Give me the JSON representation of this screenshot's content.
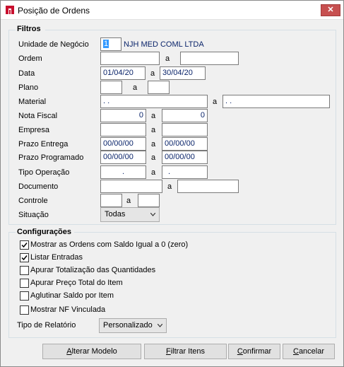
{
  "window": {
    "title": "Posição de Ordens",
    "close_glyph": "✕"
  },
  "filtros": {
    "title": "Filtros",
    "unidade": {
      "label": "Unidade de Negócio",
      "value": "1",
      "company": "NJH MED COML LTDA"
    },
    "ordem": {
      "label": "Ordem",
      "sep": "a",
      "from": "",
      "to": ""
    },
    "data": {
      "label": "Data",
      "sep": "a",
      "from": "01/04/20",
      "to": "30/04/20"
    },
    "plano": {
      "label": "Plano",
      "sep": "a",
      "from": "",
      "to": ""
    },
    "material": {
      "label": "Material",
      "sep": "a",
      "from": ". .",
      "to": ". ."
    },
    "nota_fiscal": {
      "label": "Nota Fiscal",
      "sep": "a",
      "from": "0",
      "to": "0"
    },
    "empresa": {
      "label": "Empresa",
      "sep": "a",
      "from": "",
      "to": ""
    },
    "prazo_entrega": {
      "label": "Prazo Entrega",
      "sep": "a",
      "from": "00/00/00",
      "to": "00/00/00"
    },
    "prazo_programado": {
      "label": "Prazo Programado",
      "sep": "a",
      "from": "00/00/00",
      "to": "00/00/00"
    },
    "tipo_operacao": {
      "label": "Tipo Operação",
      "sep": "a",
      "from": ".",
      "to": "."
    },
    "documento": {
      "label": "Documento",
      "sep": "a",
      "from": "",
      "to": ""
    },
    "controle": {
      "label": "Controle",
      "sep": "a",
      "from": "",
      "to": ""
    },
    "situacao": {
      "label": "Situação",
      "value": "Todas"
    }
  },
  "configuracoes": {
    "title": "Configurações",
    "options": [
      {
        "label": "Mostrar as Ordens com Saldo Igual a 0 (zero)",
        "checked": true
      },
      {
        "label": "Listar Entradas",
        "checked": true
      },
      {
        "label": "Apurar Totalização das Quantidades",
        "checked": false
      },
      {
        "label": "Apurar Preço Total do Item",
        "checked": false
      },
      {
        "label": "Aglutinar Saldo por Item",
        "checked": false
      },
      {
        "label": "Mostrar NF Vinculada",
        "checked": false
      }
    ],
    "tipo_relatorio": {
      "label": "Tipo de Relatório",
      "value": "Personalizado"
    }
  },
  "buttons": {
    "alterar_modelo": {
      "mnemonic": "A",
      "rest": "lterar Modelo"
    },
    "filtrar_itens": {
      "mnemonic": "F",
      "rest": "iltrar Itens"
    },
    "confirmar": {
      "mnemonic": "C",
      "rest": "onfirmar"
    },
    "cancelar": {
      "mnemonic": "C",
      "rest": "ancelar"
    }
  },
  "colors": {
    "field_text": "#0a246a",
    "close_bg": "#c75050",
    "selection": "#3399ff"
  }
}
